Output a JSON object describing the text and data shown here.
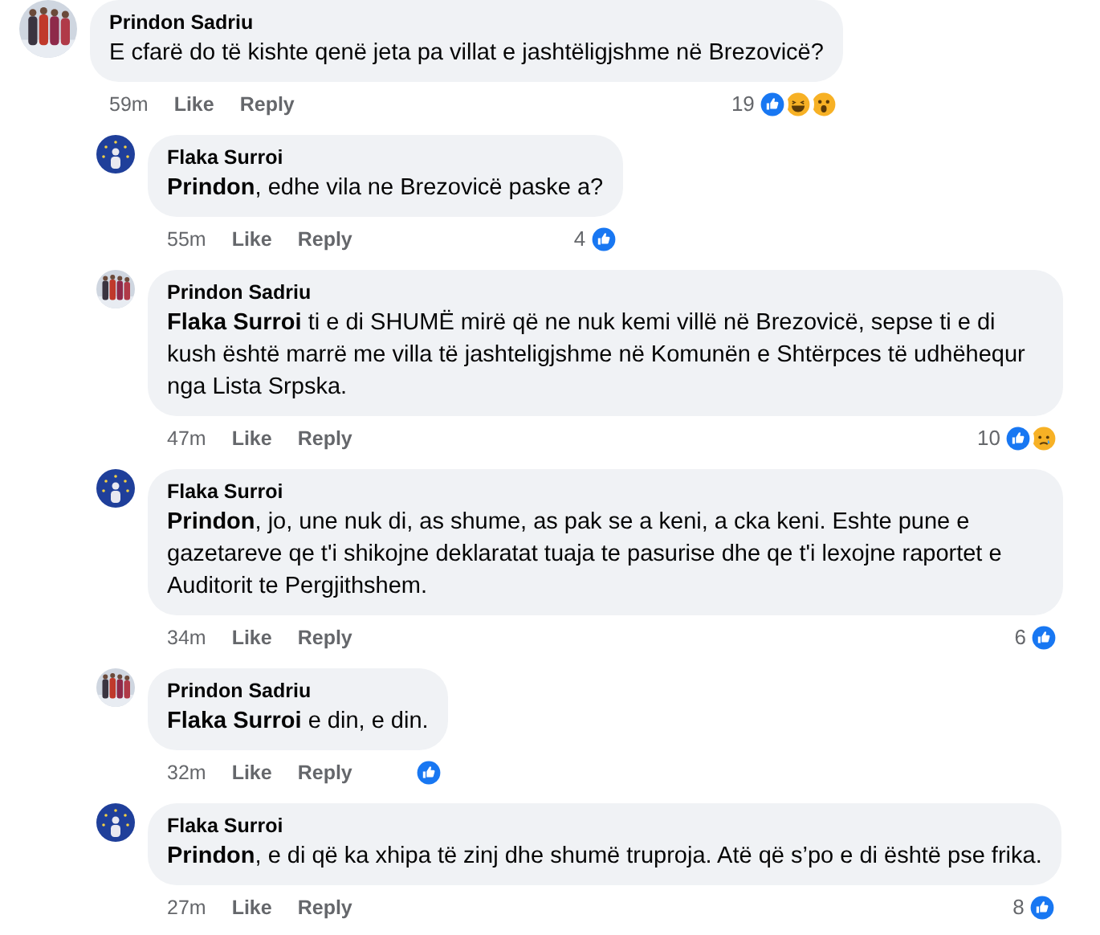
{
  "comments": [
    {
      "author": "Prindon Sadriu",
      "text": "E cfarë do të kishte qenë jeta pa villat e jashtëligjshme në Brezovicë?",
      "time": "59m",
      "like": "Like",
      "reply": "Reply",
      "reaction_count": "19",
      "reactions": [
        {
          "kind": "like"
        },
        {
          "kind": "haha"
        },
        {
          "kind": "wow"
        }
      ],
      "replies": [
        {
          "author": "Flaka Surroi",
          "text": "**Prindon**, edhe vila ne Brezovicë paske a?",
          "time": "55m",
          "like": "Like",
          "reply": "Reply",
          "reaction_count": "4",
          "reactions": [
            {
              "kind": "like"
            }
          ]
        },
        {
          "author": "Prindon Sadriu",
          "text": "**Flaka Surroi** ti e di SHUMË mirë që ne nuk kemi villë në Brezovicë, sepse ti e di kush është marrë me villa të jashteligjshme në Komunën e Shtërpces të udhëhequr nga Lista Srpska.",
          "time": "47m",
          "like": "Like",
          "reply": "Reply",
          "reaction_count": "10",
          "reactions": [
            {
              "kind": "like"
            },
            {
              "kind": "sad"
            }
          ]
        },
        {
          "author": "Flaka Surroi",
          "text": "**Prindon**, jo, une nuk di, as shume, as pak se a keni, a cka keni. Eshte pune e gazetareve qe t'i shikojne deklaratat tuaja te pasurise dhe qe t'i lexojne raportet e Auditorit te Pergjithshem.",
          "time": "34m",
          "like": "Like",
          "reply": "Reply",
          "reaction_count": "6",
          "reactions": [
            {
              "kind": "like"
            }
          ]
        },
        {
          "author": "Prindon Sadriu",
          "text": "**Flaka Surroi** e din, e din.",
          "time": "32m",
          "like": "Like",
          "reply": "Reply",
          "reactions": [
            {
              "kind": "like"
            }
          ]
        },
        {
          "author": "Flaka Surroi",
          "text": "**Prindon**, e di që ka xhipa të zinj dhe shumë truproja. Atë që s’po e di është pse frika.",
          "time": "27m",
          "like": "Like",
          "reply": "Reply",
          "reaction_count": "8",
          "reactions": [
            {
              "kind": "like"
            }
          ]
        }
      ]
    }
  ]
}
